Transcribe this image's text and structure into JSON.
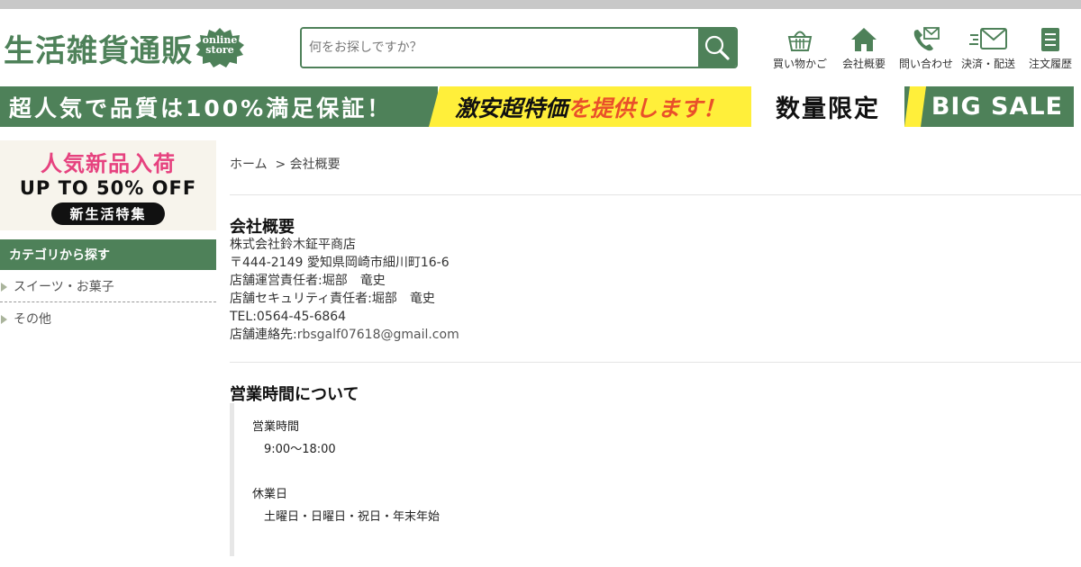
{
  "header": {
    "logo_text": "生活雑貨通販",
    "logo_badge_line1": "online",
    "logo_badge_line2": "store",
    "search_placeholder": "何をお探しですか？",
    "nav": [
      {
        "label": "買い物かご",
        "icon": "basket-icon"
      },
      {
        "label": "会社概要",
        "icon": "home-icon"
      },
      {
        "label": "問い合わせ",
        "icon": "phone-mail-icon"
      },
      {
        "label": "決済・配送",
        "icon": "delivery-mail-icon"
      },
      {
        "label": "注文履歴",
        "icon": "document-icon"
      }
    ]
  },
  "banner": {
    "part1": "超人気で品質は100%満足保証！",
    "part2_a": "激安超特価",
    "part2_b": "を提供します！",
    "part3": "数量限定",
    "part4": "BIG SALE"
  },
  "sidebar": {
    "promo": {
      "line1": "人気新品入荷",
      "line2": "UP TO 50% OFF",
      "line3": "新生活特集"
    },
    "category_heading": "カテゴリから探す",
    "categories": [
      "スイーツ・お菓子",
      "その他"
    ]
  },
  "main": {
    "breadcrumb": "ホーム  > 会社概要",
    "company": {
      "title": "会社概要",
      "lines": [
        "株式会社鈴木鉦平商店",
        "〒444-2149 愛知県岡崎市細川町16-6",
        "店舗運営責任者:堀部　竜史",
        "店舗セキュリティ責任者:堀部　竜史",
        "TEL:0564-45-6864"
      ],
      "contact_label": "店舗連絡先:",
      "contact_email": "rbsgalf07618@gmail.com"
    },
    "hours": {
      "title": "営業時間について",
      "hours_label": "営業時間",
      "hours_value": "9:00～18:00",
      "holiday_label": "休業日",
      "holiday_value": "土曜日・日曜日・祝日・年末年始"
    }
  },
  "colors": {
    "brand_green": "#4e8159",
    "banner_yellow": "#ffef3a",
    "promo_pink": "#e6427f"
  }
}
